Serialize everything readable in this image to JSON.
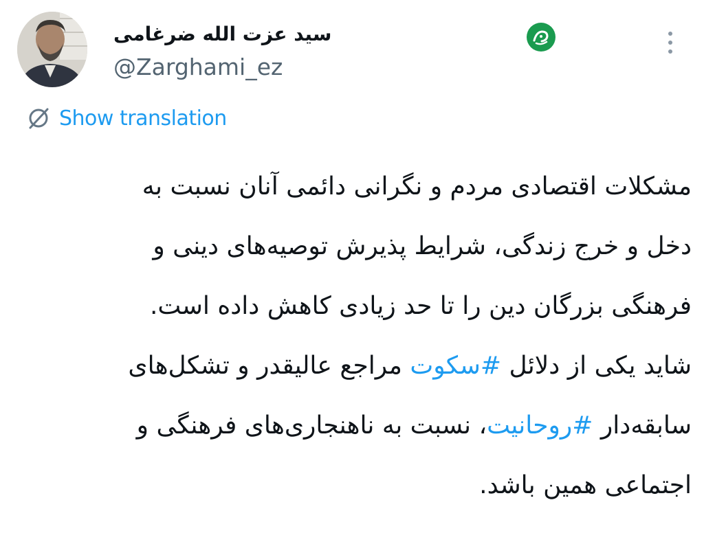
{
  "author": {
    "display_name": "سید عزت الله ضرغامی",
    "handle": "@Zarghami_ez"
  },
  "icons": {
    "avatar": "profile-photo",
    "logo": "news-agency-logo",
    "more": "more-options-icon",
    "translate": "translate-icon"
  },
  "translation": {
    "label": "Show translation"
  },
  "tweet": {
    "lines": [
      {
        "text": "مشکلات اقتصادی مردم و نگرانی دائمی آنان نسبت به"
      },
      {
        "text": "دخل و خرج زندگی، شرایط پذیرش توصیه‌های دینی و"
      },
      {
        "text": "فرهنگی بزرگان دین را تا حد زیادی کاهش داده است."
      },
      {
        "before": "شاید یکی از دلائل ",
        "hashtag": "#سکوت",
        "after": " مراجع عالیقدر و تشکل‌های"
      },
      {
        "before": "سابقه‌دار ",
        "hashtag": "#روحانیت",
        "after": "، نسبت به ناهنجاری‌های فرهنگی و"
      },
      {
        "text": "اجتماعی همین باشد."
      }
    ]
  },
  "colors": {
    "text": "#0f1419",
    "secondary": "#536471",
    "link": "#1d9bf0",
    "logo_green": "#1a9b4f"
  }
}
